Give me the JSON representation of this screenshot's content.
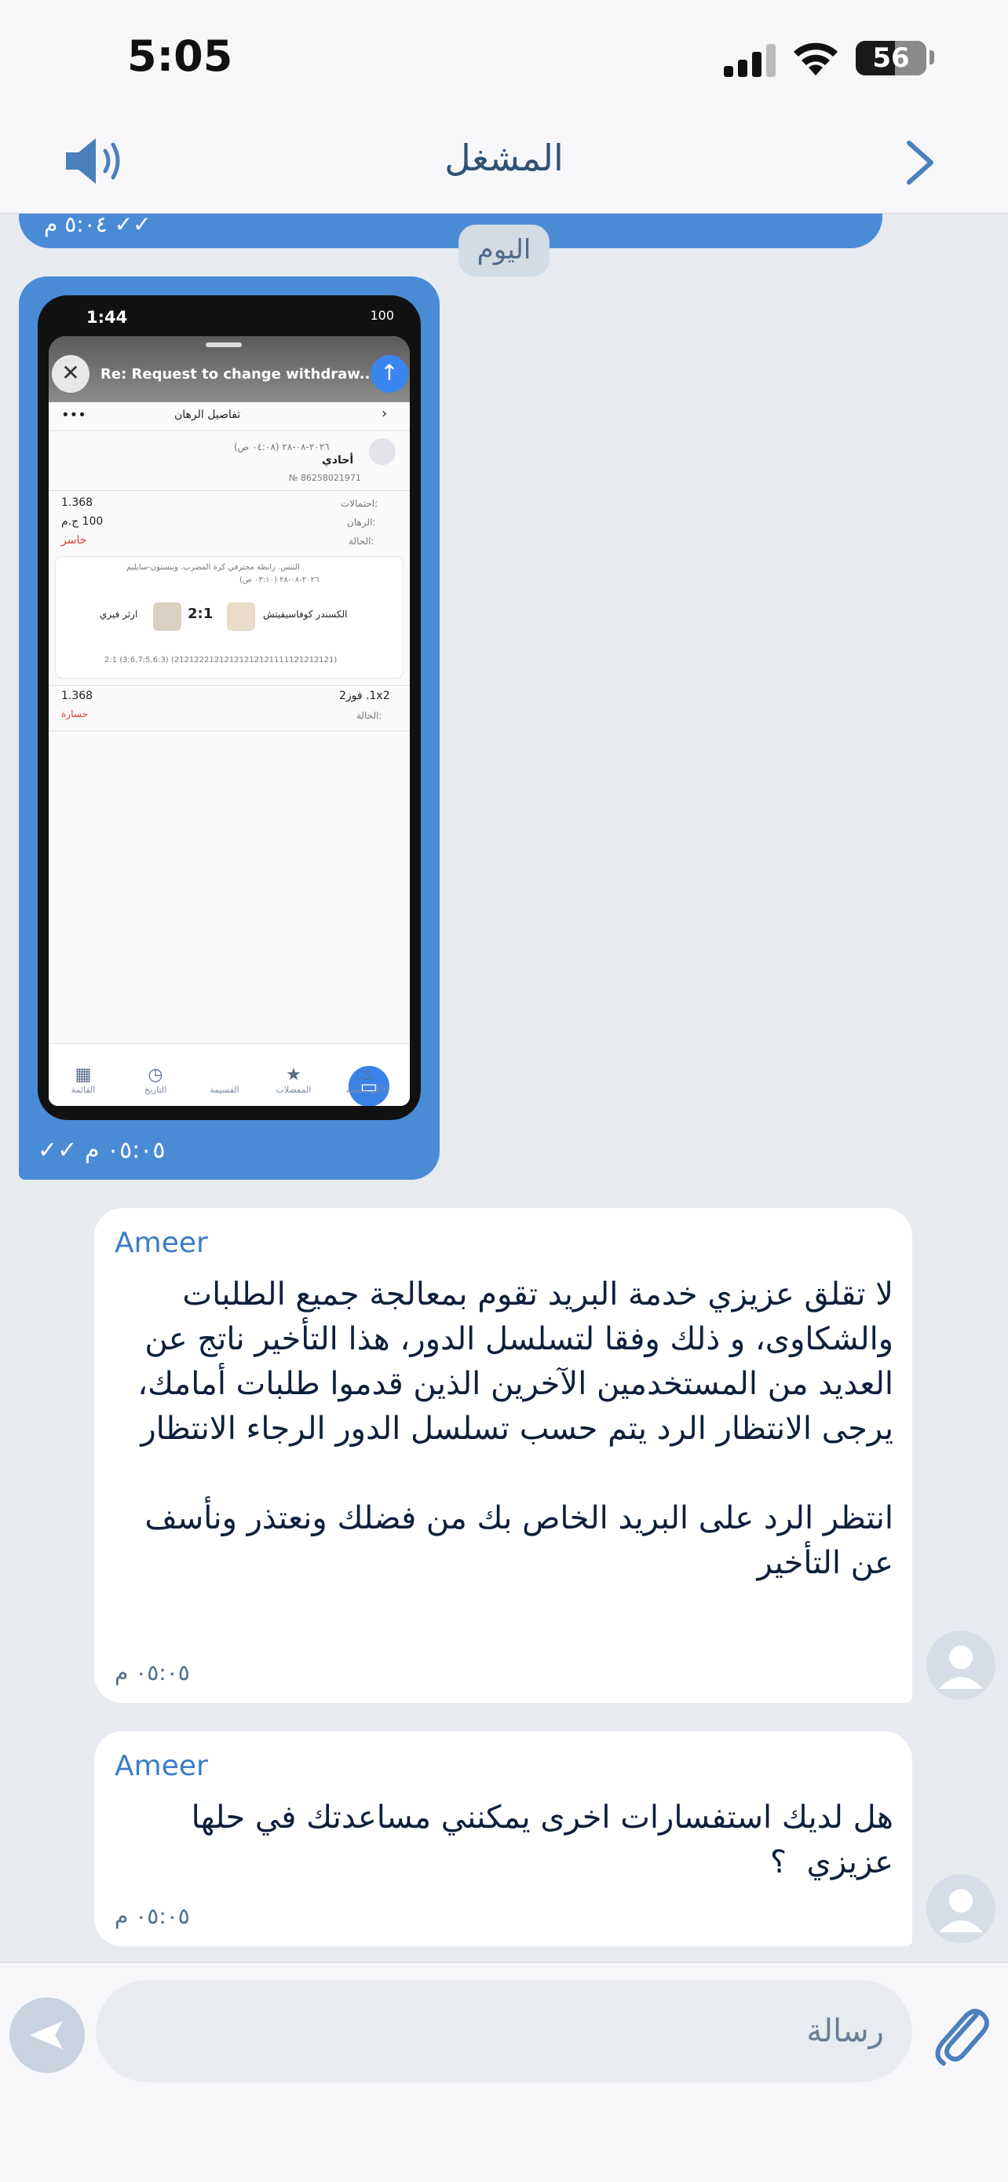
{
  "status_bar": {
    "time": "5:05",
    "battery": "56",
    "battery_level": 0.56
  },
  "header": {
    "title": "المشغل",
    "speaker_icon": "speaker-icon",
    "back_icon": "chevron-right-icon"
  },
  "chat": {
    "previous_meta": "٥:٠٤ م ✓✓",
    "date_divider": "اليوم",
    "image_message": {
      "time": "٠٥:٠٥ م",
      "checks": "✓✓",
      "screenshot": {
        "time": "1:44",
        "battery": "100",
        "subject": "Re: Request to change withdraw...",
        "screen_title": "تفاصيل الرهان",
        "bet_date": "٢٠٢٦-٠٨-٢٨ (٠٤:٠٨ ص)",
        "bet_type": "أحادي",
        "bet_number": "№ 86258021971",
        "odds_label": "احتمالات:",
        "odds_value": "1.368",
        "stake_label": "الرهان:",
        "stake_value": "100 ج.م",
        "status_label": "الحالة:",
        "status_value": "خاسر",
        "league": "التنس. رابطة محترفي كرة المضرب. وينستون-سايليم",
        "event_date": "٢٠٢٦-٠٨-٢٨ (٠٣:١٠ ص)",
        "player_home": "الكسندر كوفاسيفيتش",
        "player_away": "ارثر فيري",
        "score": "2:1",
        "score_detail": "2:1 (3:6,7:5,6:3) (21212221212121212121111121212121)",
        "pick": "1x2. فوز2",
        "pick_odds": "1.368",
        "pick_status_label": "الحالة:",
        "pick_status_value": "خسارة",
        "tabs": [
          {
            "label": "القائمة",
            "icon": "grid-icon"
          },
          {
            "label": "التاريخ",
            "icon": "clock-icon"
          },
          {
            "label": "القسيمة",
            "icon": "ticket-icon"
          },
          {
            "label": "المفضلات",
            "icon": "star-icon"
          },
          {
            "label": "الأكثر شعبية",
            "icon": "flame-icon"
          }
        ]
      }
    },
    "messages": [
      {
        "sender": "Ameer",
        "text": "لا تقلق عزيزي خدمة البريد تقوم بمعالجة جميع الطلبات والشكاوى، و ذلك وفقا لتسلسل الدور، هذا التأخير ناتج عن العديد من المستخدمين الآخرين الذين قدموا طلبات أمامك، يرجى الانتظار الرد يتم حسب تسلسل الدور الرجاء الانتظار\n\nانتظر الرد على البريد الخاص بك من فضلك ونعتذر ونأسف عن التأخير",
        "time": "٠٥:٠٥ م"
      },
      {
        "sender": "Ameer",
        "text": "هل لديك استفسارات اخرى يمكنني مساعدتك في حلها عزيزي  ؟",
        "time": "٠٥:٠٥ م"
      }
    ]
  },
  "composer": {
    "placeholder": "رسالة",
    "send_icon": "send-icon",
    "attach_icon": "paperclip-icon"
  },
  "colors": {
    "accent": "#4a8bd6",
    "background": "#e7ebf0",
    "header_title": "#2f5273",
    "sender": "#3a7cc8"
  }
}
